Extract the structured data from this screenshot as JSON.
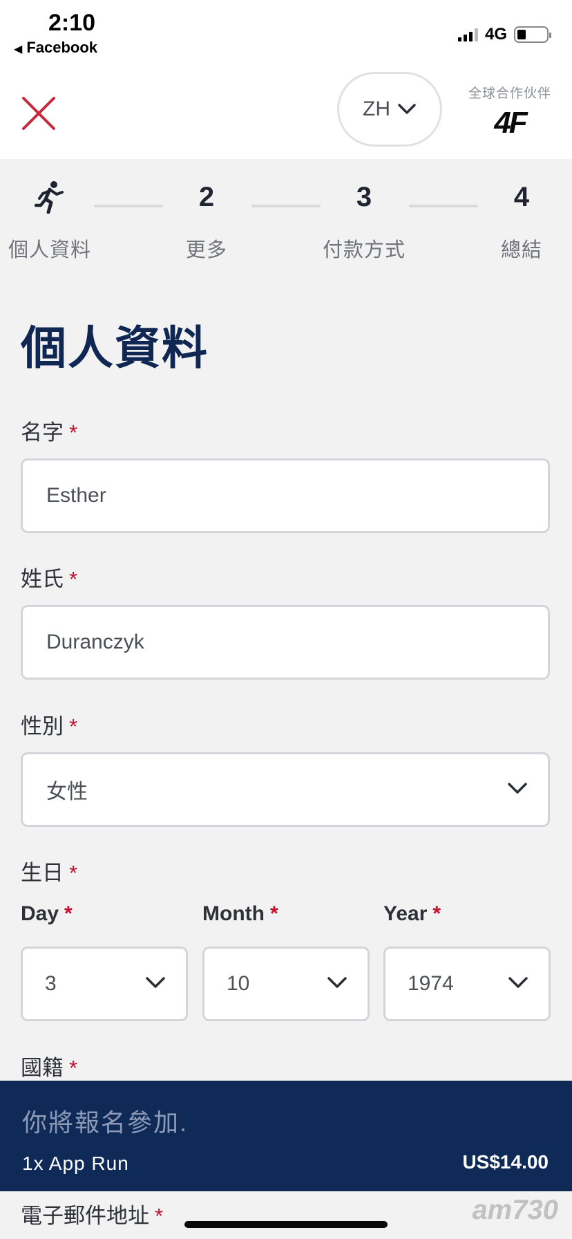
{
  "status_bar": {
    "time": "2:10",
    "back_app": "Facebook",
    "network": "4G"
  },
  "header": {
    "language": "ZH",
    "partner_label": "全球合作伙伴",
    "partner_logo": "4F"
  },
  "stepper": {
    "steps": [
      {
        "indicator": "runner-icon",
        "label": "個人資料"
      },
      {
        "indicator": "2",
        "label": "更多"
      },
      {
        "indicator": "3",
        "label": "付款方式"
      },
      {
        "indicator": "4",
        "label": "總結"
      }
    ]
  },
  "page": {
    "title": "個人資料"
  },
  "form": {
    "required_mark": "*",
    "first_name": {
      "label": "名字",
      "value": "Esther"
    },
    "last_name": {
      "label": "姓氏",
      "value": "Duranczyk"
    },
    "gender": {
      "label": "性別",
      "value": "女性"
    },
    "birthday": {
      "label": "生日",
      "day": {
        "label": "Day",
        "value": "3"
      },
      "month": {
        "label": "Month",
        "value": "10"
      },
      "year": {
        "label": "Year",
        "value": "1974"
      }
    },
    "nationality": {
      "label": "國籍"
    },
    "email": {
      "label": "電子郵件地址"
    }
  },
  "summary": {
    "title": "你將報名參加.",
    "item": "1x App Run",
    "price": "US$14.00"
  },
  "watermark": "am730",
  "colors": {
    "navy": "#0f2a57",
    "title": "#102753",
    "required": "#c8102e",
    "close": "#c8283c"
  }
}
